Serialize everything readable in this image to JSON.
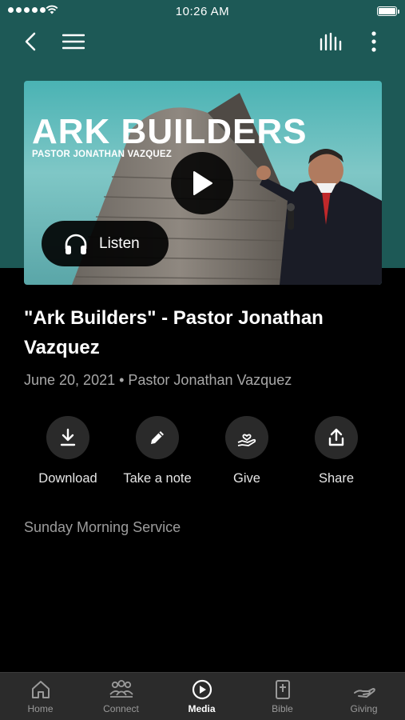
{
  "status_bar": {
    "time": "10:26 AM"
  },
  "hero": {
    "title": "ARK BUILDERS",
    "subtitle": "PASTOR JONATHAN VAZQUEZ",
    "listen_label": "Listen"
  },
  "sermon": {
    "title": "\"Ark Builders\" - Pastor Jonathan Vazquez",
    "meta": "June 20, 2021 • Pastor Jonathan Vazquez",
    "service": "Sunday Morning Service"
  },
  "actions": [
    {
      "label": "Download",
      "icon": "download-icon"
    },
    {
      "label": "Take a note",
      "icon": "pencil-icon"
    },
    {
      "label": "Give",
      "icon": "giving-hand-icon"
    },
    {
      "label": "Share",
      "icon": "share-icon"
    }
  ],
  "tabs": [
    {
      "label": "Home",
      "icon": "home-icon",
      "active": false
    },
    {
      "label": "Connect",
      "icon": "people-icon",
      "active": false
    },
    {
      "label": "Media",
      "icon": "play-circle-icon",
      "active": true
    },
    {
      "label": "Bible",
      "icon": "bible-icon",
      "active": false
    },
    {
      "label": "Giving",
      "icon": "hand-icon",
      "active": false
    }
  ],
  "colors": {
    "accent_band": "#1d5956",
    "background": "#000000",
    "tab_bar": "#2b2b2b"
  }
}
